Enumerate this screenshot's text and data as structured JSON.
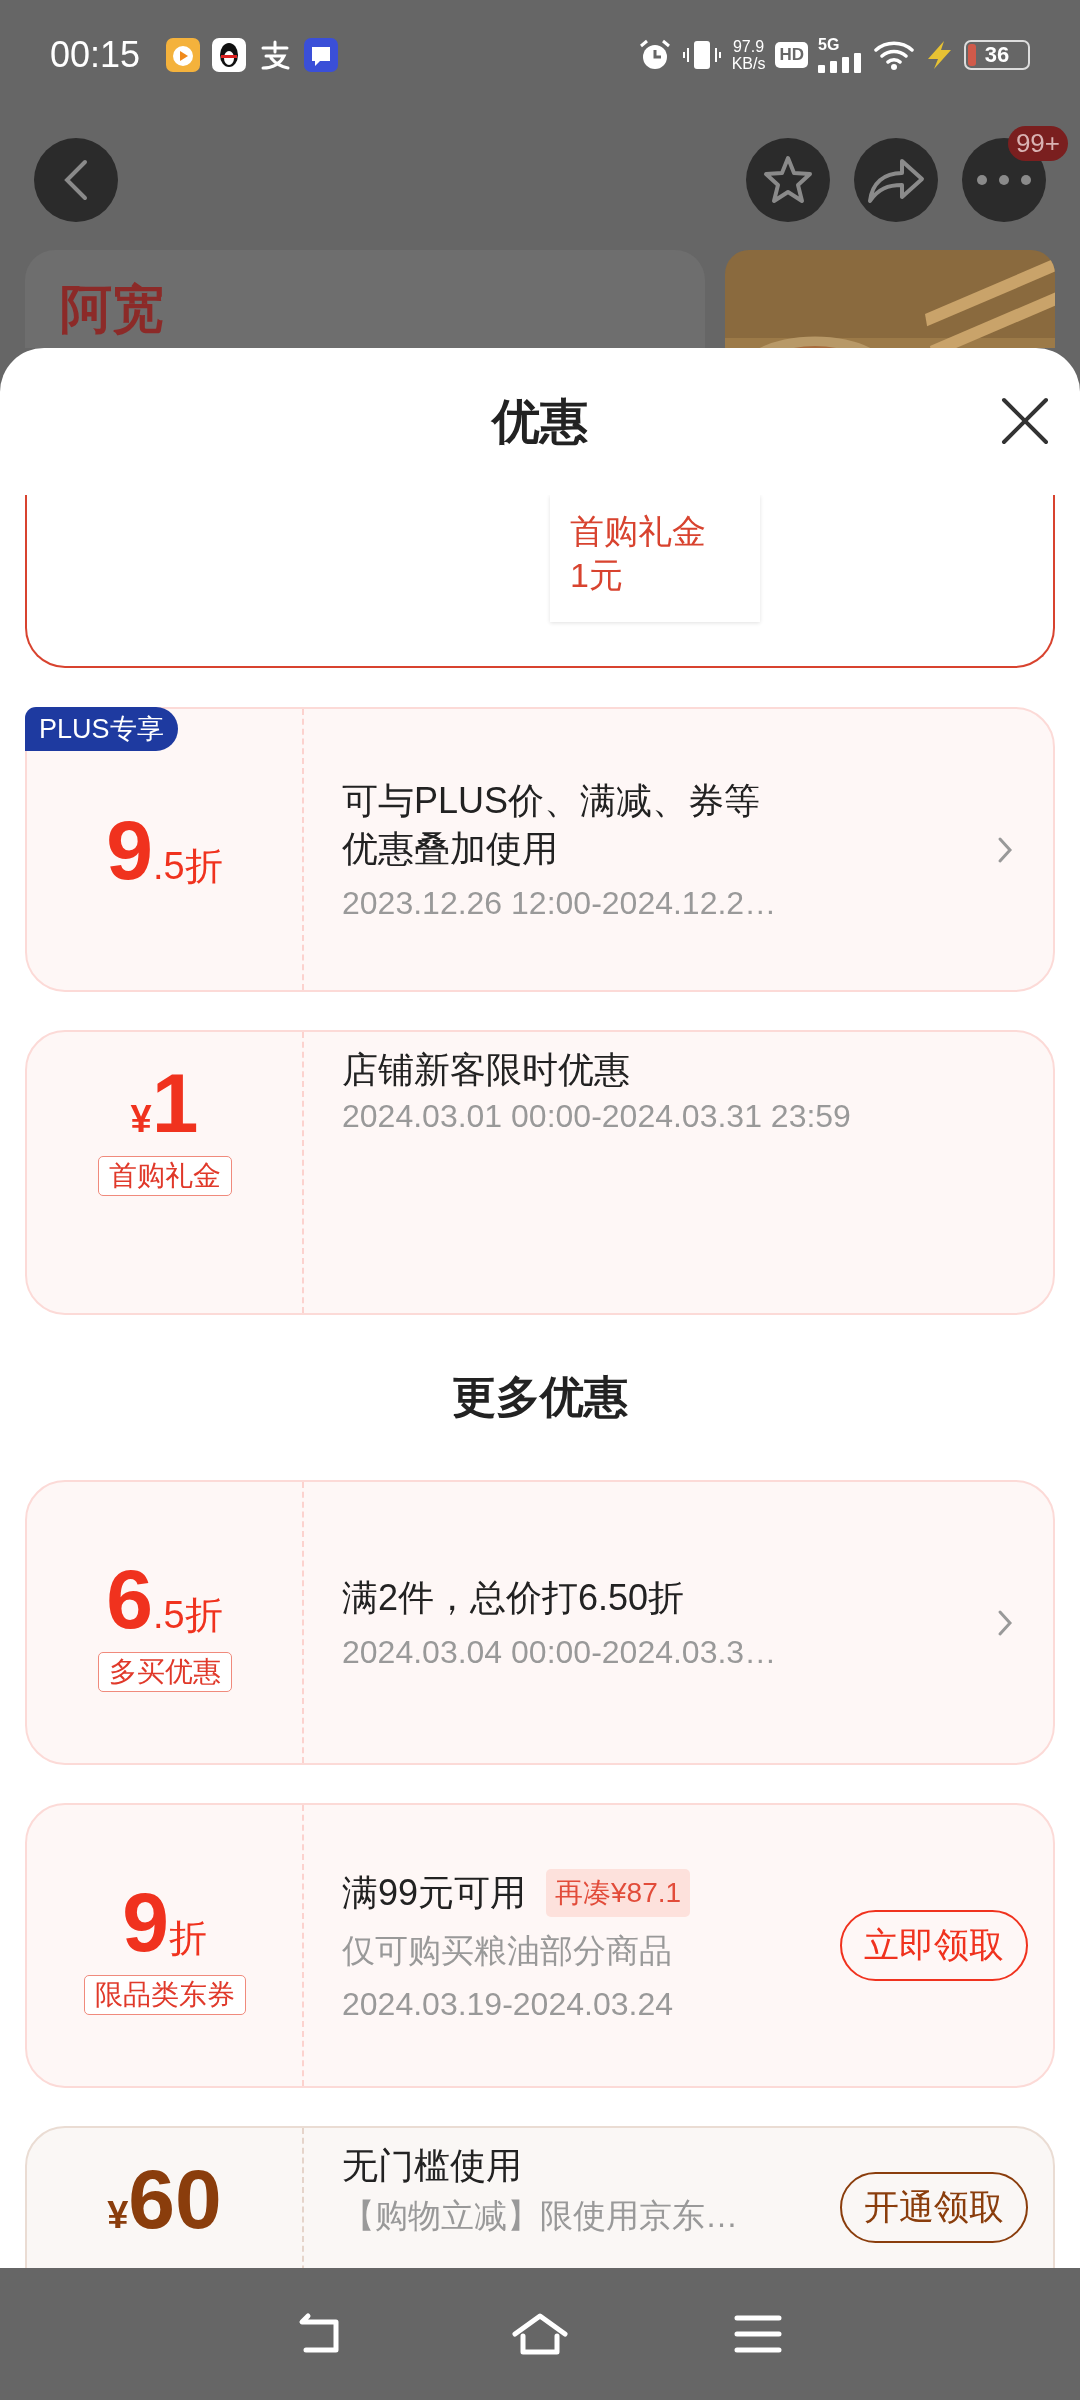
{
  "status_bar": {
    "time": "00:15",
    "network_speed": "97.9",
    "speed_unit": "KB/s",
    "hd": "HD",
    "network": "5G",
    "battery": "36"
  },
  "header": {
    "notification_badge": "99+"
  },
  "store": {
    "logo": "阿宽"
  },
  "sheet": {
    "title": "优惠"
  },
  "selected_gift": {
    "label": "首购礼金",
    "amount": "1元"
  },
  "coupons": [
    {
      "kind": "discount",
      "color": "#f0321e",
      "badge": "PLUS专享",
      "major": "9",
      "minor": ".5折",
      "title": "可与PLUS价、满减、券等优惠叠加使用",
      "date": "2023.12.26 12:00-2024.12.2…",
      "action": {
        "kind": "arrow"
      }
    },
    {
      "kind": "cash",
      "color": "#f0321e",
      "currency": "¥",
      "amount": "1",
      "tag": "首购礼金",
      "title": "店铺新客限时优惠",
      "date": "2024.03.01 00:00-2024.03.31 23:59"
    }
  ],
  "section_title": "更多优惠",
  "more_coupons": [
    {
      "kind": "discount",
      "color": "#f0321e",
      "major": "6",
      "minor": ".5折",
      "tag": "多买优惠",
      "title": "满2件，总价打6.50折",
      "date": "2024.03.04 00:00-2024.03.3…",
      "action": {
        "kind": "arrow"
      }
    },
    {
      "kind": "discount",
      "color": "#f0321e",
      "major": "9",
      "minor": "折",
      "tag": "限品类东券",
      "title": "满99元可用",
      "extra": "再凑¥87.1",
      "subtitle": "仅可购买粮油部分商品",
      "date": "2024.03.19-2024.03.24",
      "action": {
        "kind": "button",
        "label": "立即领取"
      }
    },
    {
      "kind": "cash",
      "color": "#8a3d0c",
      "currency": "¥",
      "amount": "60",
      "title": "无门槛使用",
      "subtitle": "【购物立减】限使用京东…",
      "action": {
        "kind": "button",
        "label": "开通领取"
      }
    }
  ]
}
